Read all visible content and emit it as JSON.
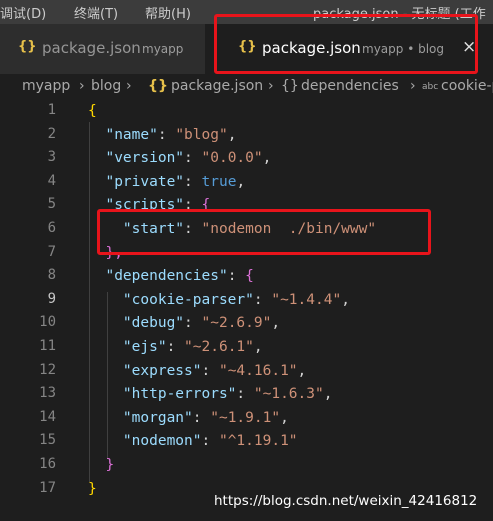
{
  "menubar": {
    "items": [
      "调试(D)",
      "终端(T)",
      "帮助(H)"
    ],
    "window_title": "package.json - 无标题 (工作"
  },
  "tabs": [
    {
      "icon": "{}",
      "title": "package.json",
      "desc": "myapp",
      "active": false
    },
    {
      "icon": "{}",
      "title": "package.json",
      "desc": "myapp • blog",
      "active": true,
      "close": "×"
    }
  ],
  "breadcrumb": {
    "folder1": "myapp",
    "folder2": "blog",
    "file_icon": "{}",
    "file": "package.json",
    "symbol1_icon": "{}",
    "symbol1": "dependencies",
    "symbol2_icon": "abc",
    "symbol2": "cookie-parser"
  },
  "editor": {
    "current_line": 9,
    "line_numbers": [
      "1",
      "2",
      "3",
      "4",
      "5",
      "6",
      "7",
      "8",
      "9",
      "10",
      "11",
      "12",
      "13",
      "14",
      "15",
      "16",
      "17"
    ],
    "lines": [
      [
        {
          "t": "{",
          "c": "br1"
        }
      ],
      [
        {
          "t": "  ",
          "c": "p"
        },
        {
          "t": "\"name\"",
          "c": "k"
        },
        {
          "t": ": ",
          "c": "p"
        },
        {
          "t": "\"blog\"",
          "c": "s"
        },
        {
          "t": ",",
          "c": "p"
        }
      ],
      [
        {
          "t": "  ",
          "c": "p"
        },
        {
          "t": "\"version\"",
          "c": "k"
        },
        {
          "t": ": ",
          "c": "p"
        },
        {
          "t": "\"0.0.0\"",
          "c": "s"
        },
        {
          "t": ",",
          "c": "p"
        }
      ],
      [
        {
          "t": "  ",
          "c": "p"
        },
        {
          "t": "\"private\"",
          "c": "k"
        },
        {
          "t": ": ",
          "c": "p"
        },
        {
          "t": "true",
          "c": "b"
        },
        {
          "t": ",",
          "c": "p"
        }
      ],
      [
        {
          "t": "  ",
          "c": "p"
        },
        {
          "t": "\"scripts\"",
          "c": "k"
        },
        {
          "t": ": ",
          "c": "p"
        },
        {
          "t": "{",
          "c": "br2"
        }
      ],
      [
        {
          "t": "    ",
          "c": "p"
        },
        {
          "t": "\"start\"",
          "c": "k"
        },
        {
          "t": ": ",
          "c": "p"
        },
        {
          "t": "\"nodemon  ./bin/www\"",
          "c": "s"
        }
      ],
      [
        {
          "t": "  ",
          "c": "p"
        },
        {
          "t": "},",
          "c": "br2"
        }
      ],
      [
        {
          "t": "  ",
          "c": "p"
        },
        {
          "t": "\"dependencies\"",
          "c": "k"
        },
        {
          "t": ": ",
          "c": "p"
        },
        {
          "t": "{",
          "c": "br2"
        }
      ],
      [
        {
          "t": "    ",
          "c": "p"
        },
        {
          "t": "\"cookie-parser\"",
          "c": "k"
        },
        {
          "t": ": ",
          "c": "p"
        },
        {
          "t": "\"~1.4.4\"",
          "c": "s"
        },
        {
          "t": ",",
          "c": "p"
        }
      ],
      [
        {
          "t": "    ",
          "c": "p"
        },
        {
          "t": "\"debug\"",
          "c": "k"
        },
        {
          "t": ": ",
          "c": "p"
        },
        {
          "t": "\"~2.6.9\"",
          "c": "s"
        },
        {
          "t": ",",
          "c": "p"
        }
      ],
      [
        {
          "t": "    ",
          "c": "p"
        },
        {
          "t": "\"ejs\"",
          "c": "k"
        },
        {
          "t": ": ",
          "c": "p"
        },
        {
          "t": "\"~2.6.1\"",
          "c": "s"
        },
        {
          "t": ",",
          "c": "p"
        }
      ],
      [
        {
          "t": "    ",
          "c": "p"
        },
        {
          "t": "\"express\"",
          "c": "k"
        },
        {
          "t": ": ",
          "c": "p"
        },
        {
          "t": "\"~4.16.1\"",
          "c": "s"
        },
        {
          "t": ",",
          "c": "p"
        }
      ],
      [
        {
          "t": "    ",
          "c": "p"
        },
        {
          "t": "\"http-errors\"",
          "c": "k"
        },
        {
          "t": ": ",
          "c": "p"
        },
        {
          "t": "\"~1.6.3\"",
          "c": "s"
        },
        {
          "t": ",",
          "c": "p"
        }
      ],
      [
        {
          "t": "    ",
          "c": "p"
        },
        {
          "t": "\"morgan\"",
          "c": "k"
        },
        {
          "t": ": ",
          "c": "p"
        },
        {
          "t": "\"~1.9.1\"",
          "c": "s"
        },
        {
          "t": ",",
          "c": "p"
        }
      ],
      [
        {
          "t": "    ",
          "c": "p"
        },
        {
          "t": "\"nodemon\"",
          "c": "k"
        },
        {
          "t": ": ",
          "c": "p"
        },
        {
          "t": "\"^1.19.1\"",
          "c": "s"
        }
      ],
      [
        {
          "t": "  ",
          "c": "p"
        },
        {
          "t": "}",
          "c": "br2"
        }
      ],
      [
        {
          "t": "}",
          "c": "br1"
        }
      ]
    ]
  },
  "watermark": "https://blog.csdn.net/weixin_42416812",
  "colors": {
    "highlight_box": "#e8141b",
    "editor_bg": "#1e1e1e",
    "json_key": "#9cdcfe",
    "json_string": "#ce9178",
    "json_keyword": "#569cd6"
  }
}
